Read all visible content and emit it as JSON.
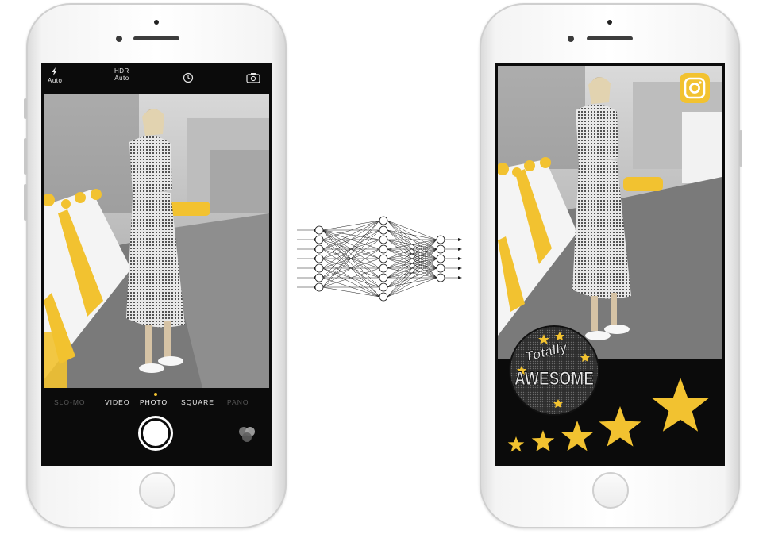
{
  "left_phone": {
    "camera_controls": {
      "flash_label": "Auto",
      "hdr_title": "HDR",
      "hdr_value": "Auto"
    },
    "camera_modes": [
      "SLO-MO",
      "VIDEO",
      "PHOTO",
      "SQUARE",
      "PANO"
    ],
    "selected_mode": "PHOTO"
  },
  "right_phone": {
    "sticker_text_top": "Totally",
    "sticker_text_main": "AWESOME",
    "star_count": 5
  },
  "colors": {
    "accent_yellow": "#f2c230",
    "screen_black": "#0b0b0b",
    "phone_silver": "#f4f4f4"
  },
  "icons": [
    "flash-icon",
    "timer-icon",
    "camera-flip-icon",
    "shutter-button",
    "filters-icon",
    "instagram-icon",
    "neural-network-diagram"
  ]
}
